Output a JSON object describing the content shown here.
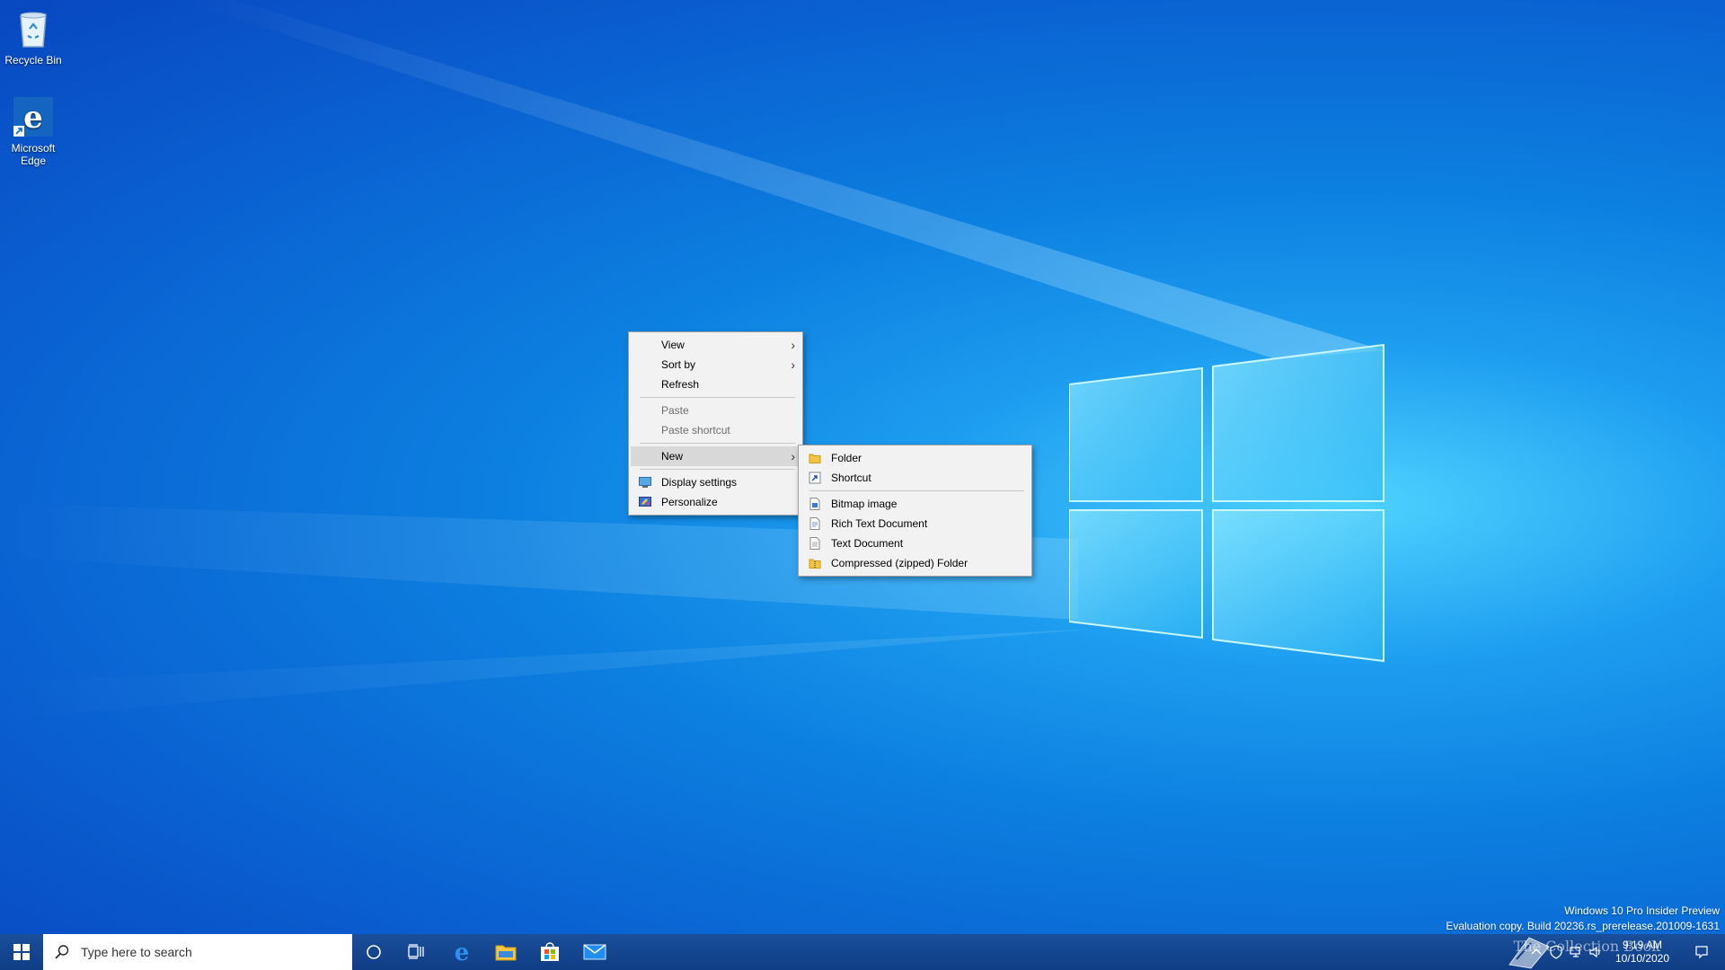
{
  "desktop": {
    "icons": [
      {
        "label": "Recycle Bin",
        "icon": "recycle-bin-icon"
      },
      {
        "label": "Microsoft Edge",
        "icon": "edge-icon"
      }
    ]
  },
  "context_menu": {
    "items": [
      {
        "label": "View",
        "submenu": true,
        "enabled": true
      },
      {
        "label": "Sort by",
        "submenu": true,
        "enabled": true
      },
      {
        "label": "Refresh",
        "enabled": true
      },
      {
        "label": "Paste",
        "enabled": false
      },
      {
        "label": "Paste shortcut",
        "enabled": false
      },
      {
        "label": "New",
        "submenu": true,
        "enabled": true,
        "highlighted": true
      },
      {
        "label": "Display settings",
        "icon": "display-settings-icon",
        "enabled": true
      },
      {
        "label": "Personalize",
        "icon": "personalize-icon",
        "enabled": true
      }
    ]
  },
  "new_submenu": {
    "items": [
      {
        "label": "Folder",
        "icon": "folder-icon"
      },
      {
        "label": "Shortcut",
        "icon": "shortcut-icon"
      },
      {
        "label": "Bitmap image",
        "icon": "bitmap-image-icon"
      },
      {
        "label": "Rich Text Document",
        "icon": "rich-text-document-icon"
      },
      {
        "label": "Text Document",
        "icon": "text-document-icon"
      },
      {
        "label": "Compressed (zipped) Folder",
        "icon": "zip-folder-icon"
      }
    ]
  },
  "watermark": {
    "line1": "Windows 10 Pro Insider Preview",
    "line2": "Evaluation copy. Build 20236.rs_prerelease.201009-1631"
  },
  "taskbar": {
    "search_placeholder": "Type here to search",
    "pinned": [
      "cortana-icon",
      "task-view-icon",
      "edge-icon",
      "file-explorer-icon",
      "store-icon",
      "mail-icon"
    ],
    "clock": {
      "time": "9:19 AM",
      "date": "10/10/2020"
    },
    "brand_text": "The Collection Book"
  },
  "colors": {
    "menu_bg": "#f2f2f2",
    "highlight": "#d9d9d9",
    "taskbar": "#0f3d85"
  }
}
